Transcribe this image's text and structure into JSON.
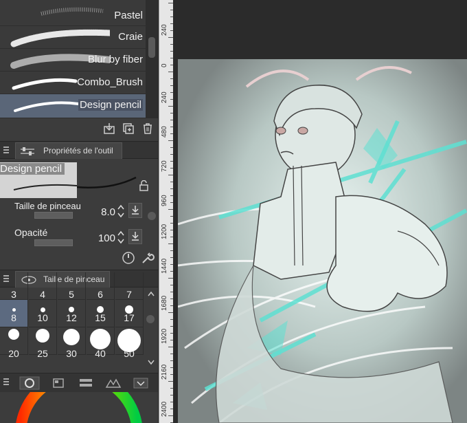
{
  "brushes": [
    {
      "label": "Pastel"
    },
    {
      "label": "Craie"
    },
    {
      "label": "Blur by fiber"
    },
    {
      "label": "Combo_Brush"
    },
    {
      "label": "Design pencil",
      "selected": true
    }
  ],
  "tool_properties": {
    "tab_label": "Propriétés de l'outil",
    "preview_name": "Design pencil",
    "brush_size_label": "Taille de pinceau",
    "brush_size_value": "8.0",
    "opacity_label": "Opacité",
    "opacity_value": "100"
  },
  "brush_size_panel": {
    "tab_label": "Taille de pinceau",
    "row1": [
      "3",
      "4",
      "5",
      "6",
      "7"
    ],
    "row2": [
      "8",
      "10",
      "12",
      "15",
      "17"
    ],
    "row3": [
      "20",
      "25",
      "30",
      "40",
      "50"
    ],
    "selected": "8"
  },
  "ruler": {
    "labels": [
      "240",
      "0",
      "240",
      "480",
      "720",
      "960",
      "1200",
      "1440",
      "1680",
      "1920",
      "2160",
      "2400"
    ]
  },
  "colors": {
    "panel_bg": "#3c3c3c",
    "selection": "#5a6678",
    "accent_cyan": "#5ee0d2",
    "ruler_bg": "#e6e6e6"
  },
  "icons": [
    "import-icon",
    "new-brush-icon",
    "trash-icon",
    "lock-icon",
    "download-icon",
    "settings-dial-icon",
    "wrench-icon"
  ]
}
